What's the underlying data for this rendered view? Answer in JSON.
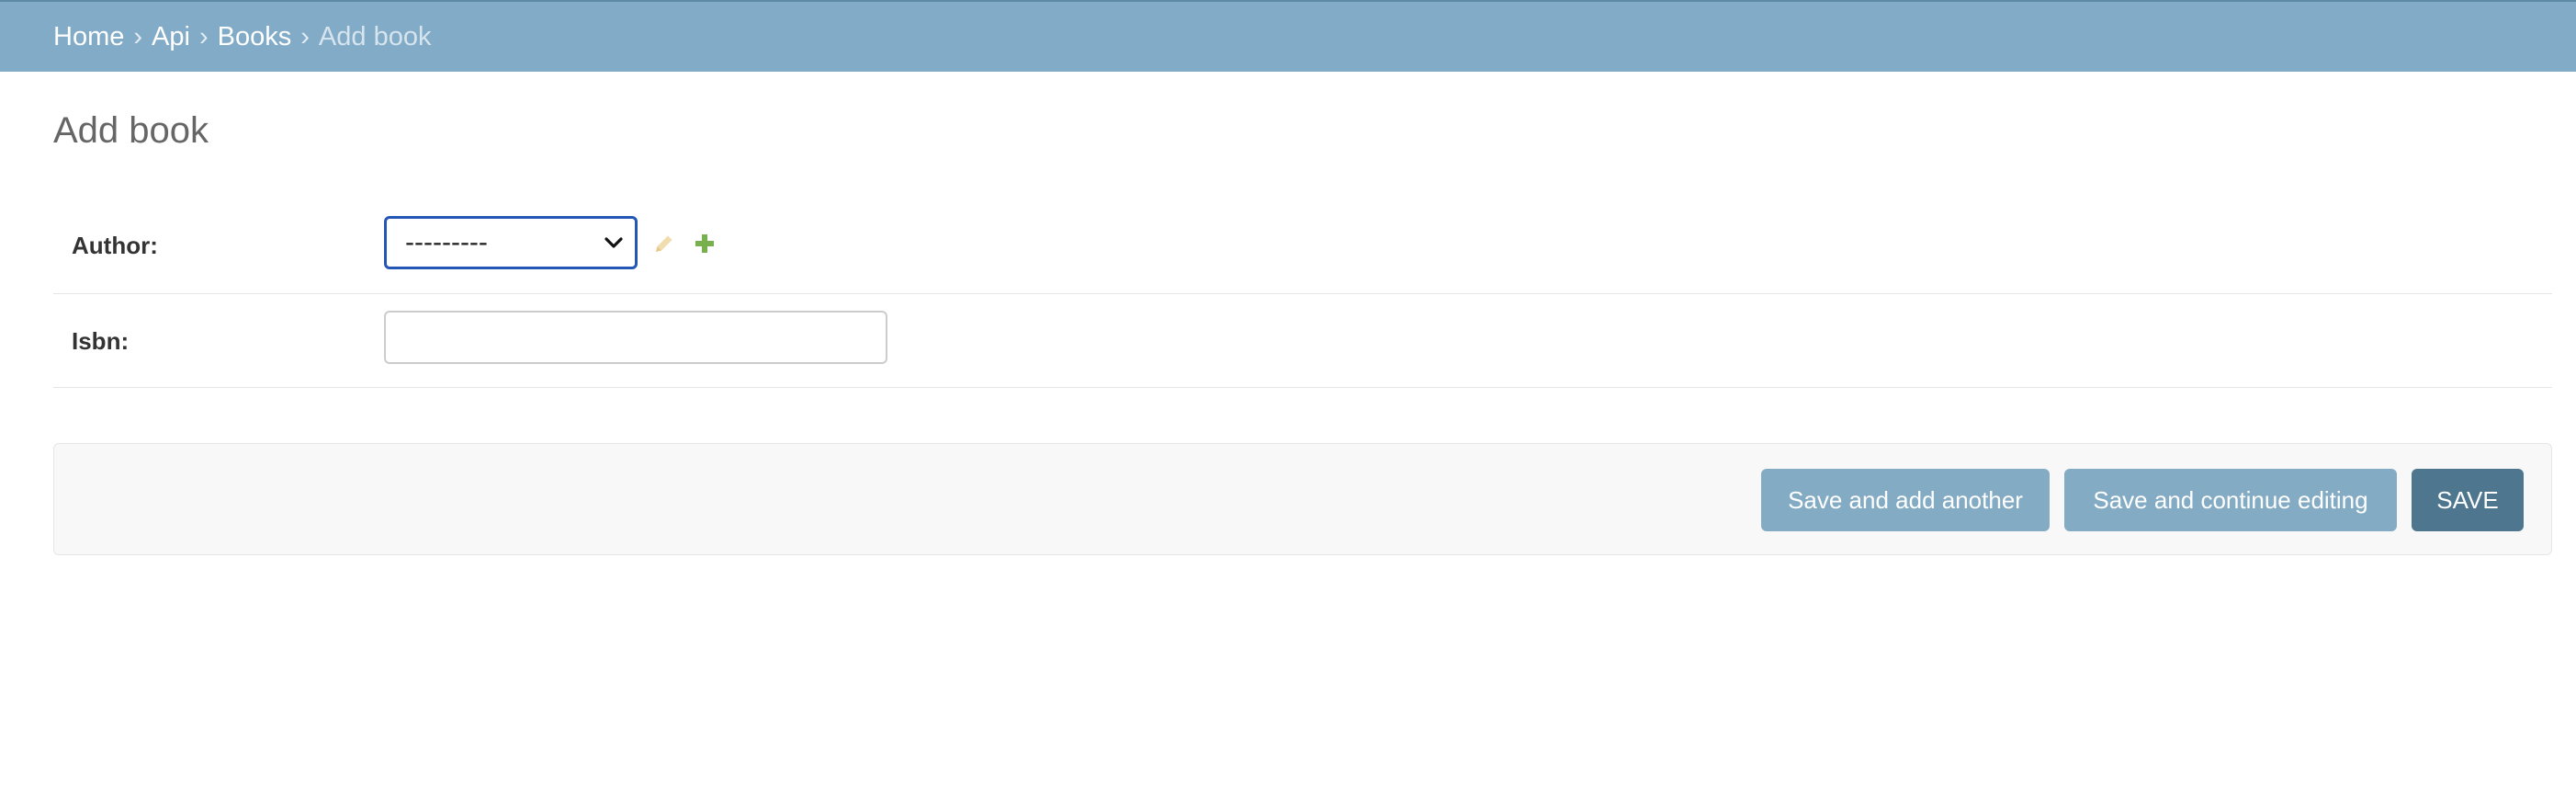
{
  "breadcrumbs": {
    "items": [
      "Home",
      "Api",
      "Books"
    ],
    "separator": "›",
    "current": "Add book"
  },
  "page": {
    "title": "Add book"
  },
  "form": {
    "author": {
      "label": "Author:",
      "selected_value": "---------"
    },
    "isbn": {
      "label": "Isbn:",
      "value": ""
    }
  },
  "actions": {
    "save_add_another": "Save and add another",
    "save_continue": "Save and continue editing",
    "save": "SAVE"
  },
  "colors": {
    "header_bg": "#81abc7",
    "primary_button": "#4f768f",
    "secondary_button": "#83abc4",
    "focus_border": "#2456b5",
    "add_icon": "#78b04e",
    "edit_icon": "#f0d9a8"
  },
  "icons": [
    "chevron-down-icon",
    "pencil-icon",
    "plus-icon"
  ]
}
